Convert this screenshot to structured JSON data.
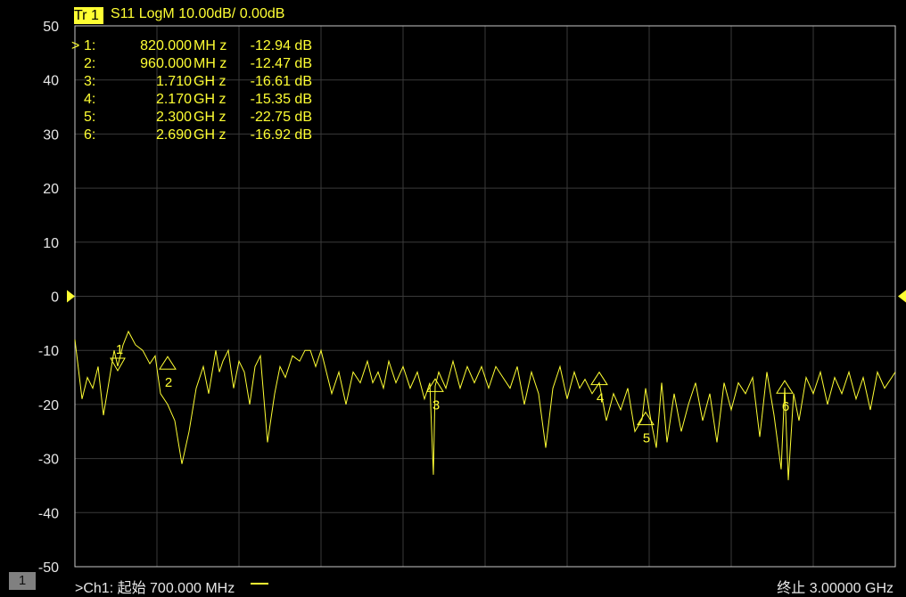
{
  "trace": {
    "badge": "Tr  1",
    "title": "S11 LogM 10.00dB/  0.00dB"
  },
  "markers": [
    {
      "id": "1:",
      "active": ">",
      "freq": "820.000",
      "unit": "MH z",
      "value": "-12.94 dB"
    },
    {
      "id": "2:",
      "active": "",
      "freq": "960.000",
      "unit": "MH z",
      "value": "-12.47 dB"
    },
    {
      "id": "3:",
      "active": "",
      "freq": "1.710",
      "unit": "GH z",
      "value": "-16.61 dB"
    },
    {
      "id": "4:",
      "active": "",
      "freq": "2.170",
      "unit": "GH z",
      "value": "-15.35 dB"
    },
    {
      "id": "5:",
      "active": "",
      "freq": "2.300",
      "unit": "GH z",
      "value": "-22.75 dB"
    },
    {
      "id": "6:",
      "active": "",
      "freq": "2.690",
      "unit": "GH z",
      "value": "-16.92 dB"
    }
  ],
  "status": {
    "channel_number": "1",
    "start_text": ">Ch1:  起始  700.000 MHz",
    "stop_text": "终止  3.00000 GHz"
  },
  "colors": {
    "trace": "#ffff33",
    "grid": "#3a3a3a",
    "frame": "#c8c8c8",
    "background": "#000000"
  },
  "chart_data": {
    "type": "line",
    "title": "S11 LogM 10.00dB/  0.00dB",
    "xlim": [
      700,
      3000
    ],
    "ylim": [
      -50,
      50
    ],
    "x_unit": "MHz",
    "y_unit": "dB",
    "grid": true,
    "yticks": [
      50,
      40,
      30,
      20,
      10,
      0,
      -10,
      -20,
      -30,
      -40,
      -50
    ],
    "reference_level": 0,
    "markers": [
      {
        "label": "1",
        "x": 820,
        "y": -12.94
      },
      {
        "label": "2",
        "x": 960,
        "y": -12.47
      },
      {
        "label": "3",
        "x": 1710,
        "y": -16.61
      },
      {
        "label": "4",
        "x": 2170,
        "y": -15.35
      },
      {
        "label": "5",
        "x": 2300,
        "y": -22.75
      },
      {
        "label": "6",
        "x": 2690,
        "y": -16.92
      }
    ],
    "series": [
      {
        "x": [
          700,
          720,
          735,
          750,
          765,
          780,
          795,
          810,
          820,
          835,
          850,
          870,
          890,
          910,
          925,
          940,
          960,
          980,
          1000,
          1020,
          1040,
          1060,
          1075,
          1085,
          1095,
          1105,
          1115,
          1130,
          1145,
          1160,
          1175,
          1190,
          1205,
          1220,
          1240,
          1260,
          1275,
          1290,
          1310,
          1330,
          1345,
          1360,
          1375,
          1390,
          1405,
          1420,
          1440,
          1460,
          1480,
          1500,
          1520,
          1535,
          1550,
          1565,
          1580,
          1600,
          1620,
          1640,
          1660,
          1680,
          1695,
          1705,
          1710,
          1720,
          1740,
          1760,
          1780,
          1800,
          1820,
          1840,
          1860,
          1880,
          1900,
          1920,
          1940,
          1960,
          1980,
          2000,
          2020,
          2040,
          2060,
          2080,
          2100,
          2115,
          2130,
          2150,
          2170,
          2190,
          2210,
          2230,
          2250,
          2270,
          2290,
          2300,
          2315,
          2330,
          2345,
          2360,
          2380,
          2400,
          2420,
          2440,
          2460,
          2480,
          2500,
          2520,
          2540,
          2560,
          2580,
          2600,
          2620,
          2640,
          2660,
          2680,
          2690,
          2700,
          2715,
          2730,
          2750,
          2770,
          2790,
          2810,
          2830,
          2850,
          2870,
          2890,
          2910,
          2930,
          2950,
          2970,
          2990,
          3000
        ],
        "values": [
          -8,
          -19,
          -15,
          -17,
          -13,
          -22,
          -16,
          -10,
          -12.94,
          -9,
          -6.5,
          -9,
          -10,
          -12.47,
          -11,
          -18,
          -20,
          -23,
          -31,
          -25,
          -17,
          -13,
          -18,
          -14,
          -10,
          -14,
          -12,
          -10,
          -17,
          -12,
          -14,
          -20,
          -13,
          -11,
          -27,
          -18,
          -13,
          -15,
          -11,
          -12,
          -10,
          -10,
          -13,
          -10,
          -14,
          -18,
          -14,
          -20,
          -14,
          -16,
          -12,
          -16,
          -14,
          -17,
          -12,
          -16,
          -13,
          -17,
          -14,
          -19,
          -16,
          -33,
          -16.61,
          -14,
          -17,
          -12,
          -17,
          -13,
          -16,
          -13,
          -17,
          -13,
          -15,
          -17,
          -13,
          -20,
          -14,
          -18,
          -28,
          -17,
          -13,
          -19,
          -14,
          -17,
          -15.35,
          -18,
          -16,
          -23,
          -18,
          -21,
          -17,
          -25,
          -22.75,
          -17,
          -23,
          -28,
          -16,
          -27,
          -18,
          -25,
          -20,
          -16,
          -23,
          -18,
          -27,
          -16,
          -21,
          -16,
          -18,
          -15,
          -26,
          -14,
          -22,
          -32,
          -16.92,
          -34,
          -18,
          -23,
          -15,
          -18,
          -14,
          -20,
          -15,
          -18,
          -14,
          -19,
          -15,
          -21,
          -14,
          -17,
          -15,
          -14
        ]
      }
    ]
  }
}
